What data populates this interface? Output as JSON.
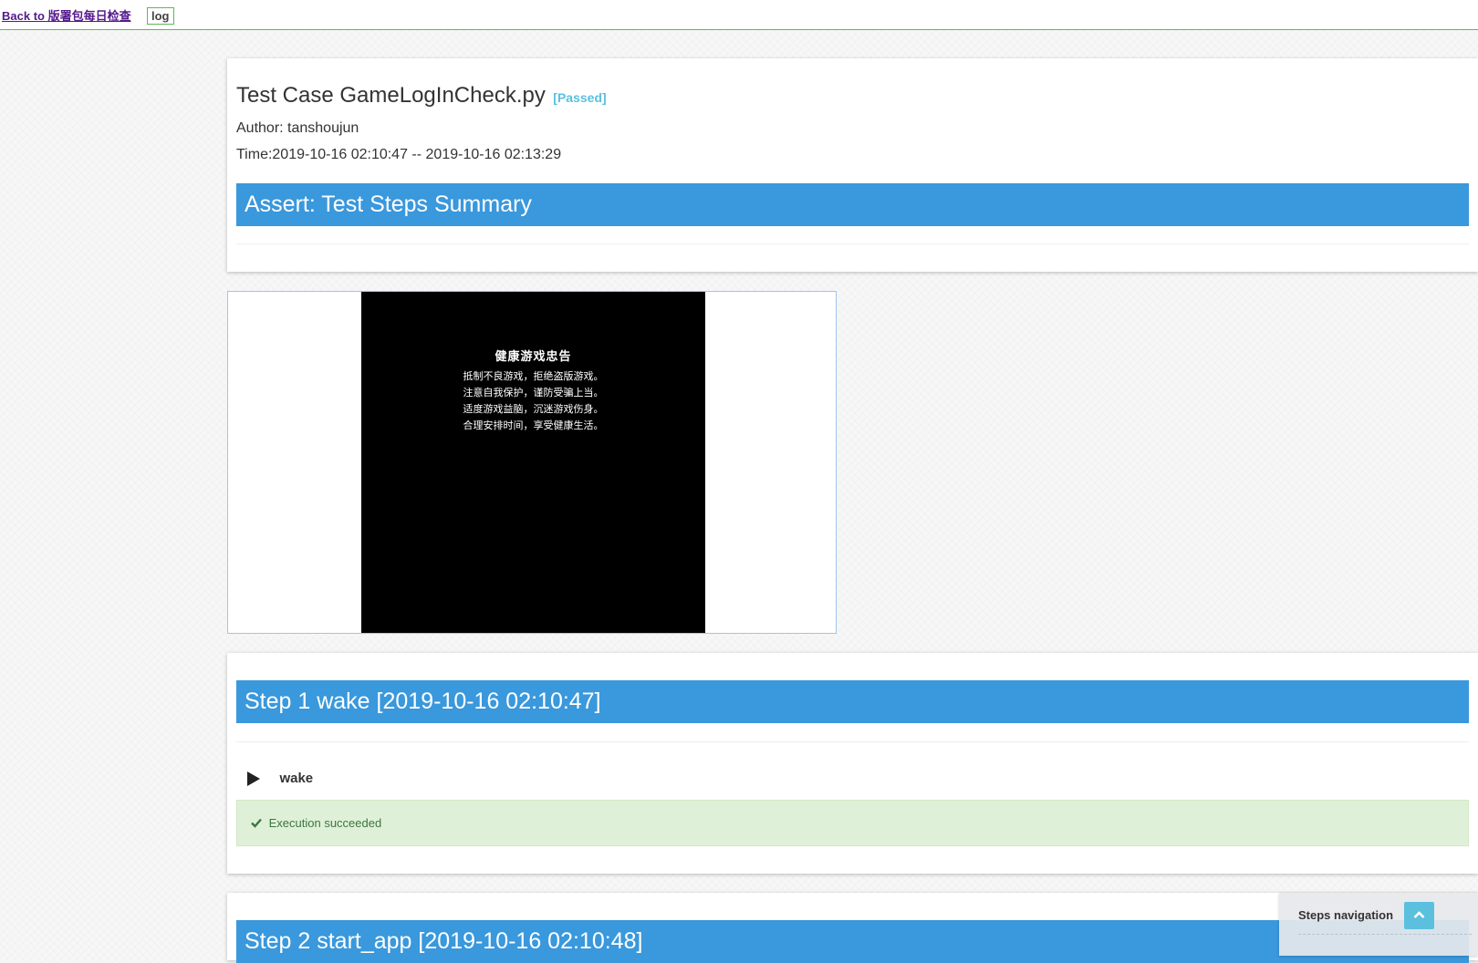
{
  "topbar": {
    "back_link": "Back to 版署包每日检查",
    "log_button": "log"
  },
  "summary": {
    "title": "Test Case GameLogInCheck.py",
    "status": "[Passed]",
    "author": "Author: tanshoujun",
    "time": "Time:2019-10-16 02:10:47 -- 2019-10-16 02:13:29",
    "header": "Assert: Test Steps Summary"
  },
  "screenshot": {
    "title": "健康游戏忠告",
    "lines": [
      "抵制不良游戏，拒绝盗版游戏。",
      "注意自我保护，谨防受骗上当。",
      "适度游戏益脑，沉迷游戏伤身。",
      "合理安排时间，享受健康生活。"
    ]
  },
  "steps": [
    {
      "header": "Step 1 wake [2019-10-16 02:10:47]",
      "action": "wake",
      "result": "Execution succeeded"
    },
    {
      "header": "Step 2 start_app [2019-10-16 02:10:48]"
    }
  ],
  "nav": {
    "label": "Steps navigation",
    "icon": "chevron-up-icon"
  },
  "colors": {
    "header_blue": "#3a98dc",
    "passed": "#5bc0de",
    "success_bg": "#dff0d8",
    "success_text": "#3c763d",
    "divider_green": "#5cb85c"
  }
}
